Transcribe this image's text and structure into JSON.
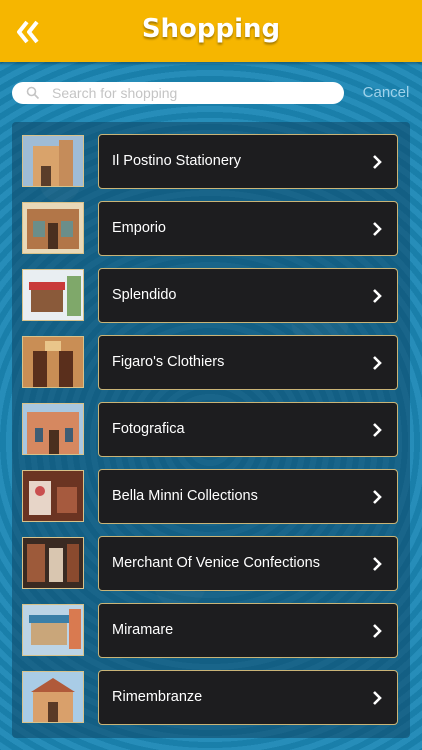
{
  "header": {
    "title": "Shopping",
    "back_icon": "double-chevron-left-icon"
  },
  "search": {
    "placeholder": "Search for shopping",
    "value": "",
    "cancel_label": "Cancel"
  },
  "colors": {
    "header": "#f6b600",
    "background": "#1b87b5",
    "cell": "#1d1d1f",
    "cell_border": "#c9b477"
  },
  "items": [
    {
      "label": "Il Postino Stationery"
    },
    {
      "label": "Emporio"
    },
    {
      "label": "Splendido"
    },
    {
      "label": "Figaro's Clothiers"
    },
    {
      "label": "Fotografica"
    },
    {
      "label": "Bella Minni Collections"
    },
    {
      "label": "Merchant Of Venice Confections"
    },
    {
      "label": "Miramare"
    },
    {
      "label": "Rimembranze"
    }
  ]
}
